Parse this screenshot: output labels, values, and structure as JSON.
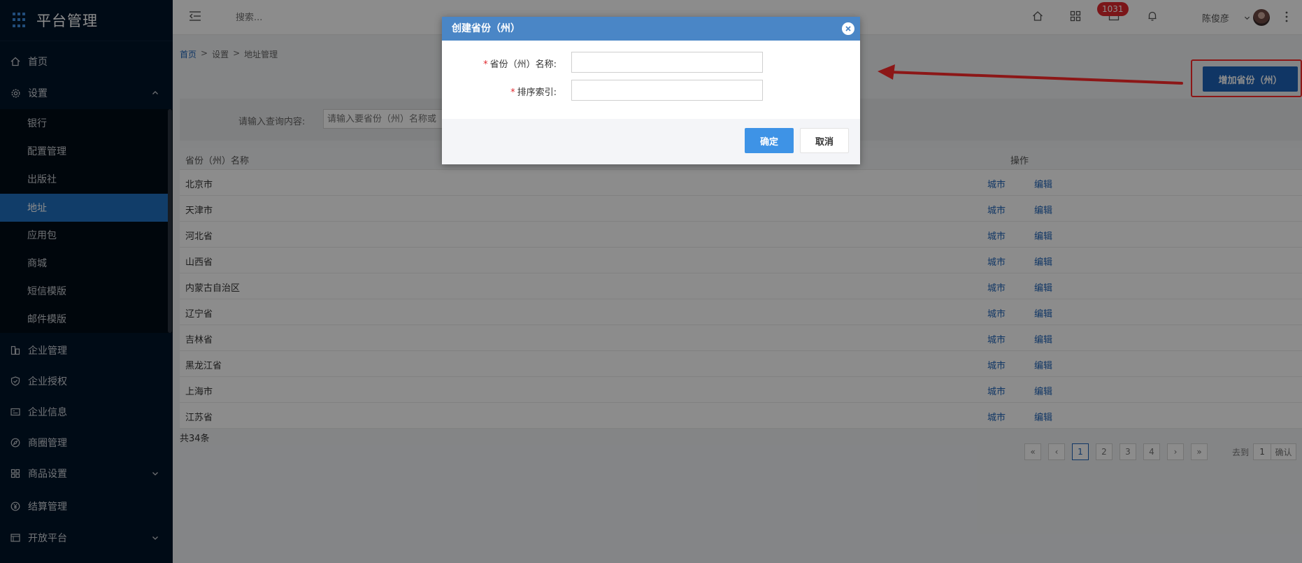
{
  "app": {
    "title": "平台管理"
  },
  "sidebar": {
    "items": [
      {
        "label": "首页",
        "icon": "home-icon"
      },
      {
        "label": "设置",
        "icon": "gear-icon",
        "expanded": true
      },
      {
        "label": "企业管理",
        "icon": "building-icon"
      },
      {
        "label": "企业授权",
        "icon": "shield-check-icon"
      },
      {
        "label": "企业信息",
        "icon": "id-card-icon"
      },
      {
        "label": "商圈管理",
        "icon": "compass-icon"
      },
      {
        "label": "商品设置",
        "icon": "grid-icon"
      },
      {
        "label": "结算管理",
        "icon": "yen-icon"
      },
      {
        "label": "开放平台",
        "icon": "browser-icon"
      }
    ],
    "settings_children": [
      {
        "label": "银行"
      },
      {
        "label": "配置管理"
      },
      {
        "label": "出版社"
      },
      {
        "label": "地址",
        "active": true
      },
      {
        "label": "应用包"
      },
      {
        "label": "商城"
      },
      {
        "label": "短信模版"
      },
      {
        "label": "邮件模版"
      }
    ]
  },
  "header": {
    "search_placeholder": "搜索...",
    "notification_count": "1031",
    "user_name": "陈俊彦"
  },
  "breadcrumb": {
    "home": "首页",
    "sep": ">",
    "level1": "设置",
    "current": "地址管理"
  },
  "toolbar": {
    "add_label": "增加省份（州）"
  },
  "query": {
    "label": "请输入查询内容:",
    "placeholder": "请输入要省份（州）名称或"
  },
  "table": {
    "columns": {
      "name": "省份（州）名称",
      "ops": "操作"
    },
    "rows": [
      {
        "name": "北京市",
        "city": "城市",
        "edit": "编辑"
      },
      {
        "name": "天津市",
        "city": "城市",
        "edit": "编辑"
      },
      {
        "name": "河北省",
        "city": "城市",
        "edit": "编辑"
      },
      {
        "name": "山西省",
        "city": "城市",
        "edit": "编辑"
      },
      {
        "name": "内蒙古自治区",
        "city": "城市",
        "edit": "编辑"
      },
      {
        "name": "辽宁省",
        "city": "城市",
        "edit": "编辑"
      },
      {
        "name": "吉林省",
        "city": "城市",
        "edit": "编辑"
      },
      {
        "name": "黑龙江省",
        "city": "城市",
        "edit": "编辑"
      },
      {
        "name": "上海市",
        "city": "城市",
        "edit": "编辑"
      },
      {
        "name": "江苏省",
        "city": "城市",
        "edit": "编辑"
      }
    ],
    "total": "共34条"
  },
  "pagination": {
    "first": "«",
    "prev": "‹",
    "pages": [
      "1",
      "2",
      "3",
      "4"
    ],
    "current": "1",
    "next": "›",
    "last": "»",
    "goto_label": "去到",
    "goto_value": "1",
    "confirm": "确认"
  },
  "modal": {
    "title": "创建省份（州）",
    "fields": [
      {
        "label": "省份（州）名称:",
        "required": "*",
        "value": ""
      },
      {
        "label": "排序索引:",
        "required": "*",
        "value": ""
      }
    ],
    "ok_label": "确定",
    "cancel_label": "取消"
  },
  "colors": {
    "sidebar_bg": "#001529",
    "primary": "#1e63b8",
    "modal_header": "#4a86c6",
    "ok_button": "#3e93e6",
    "annotation_red": "#ff2a2a"
  }
}
